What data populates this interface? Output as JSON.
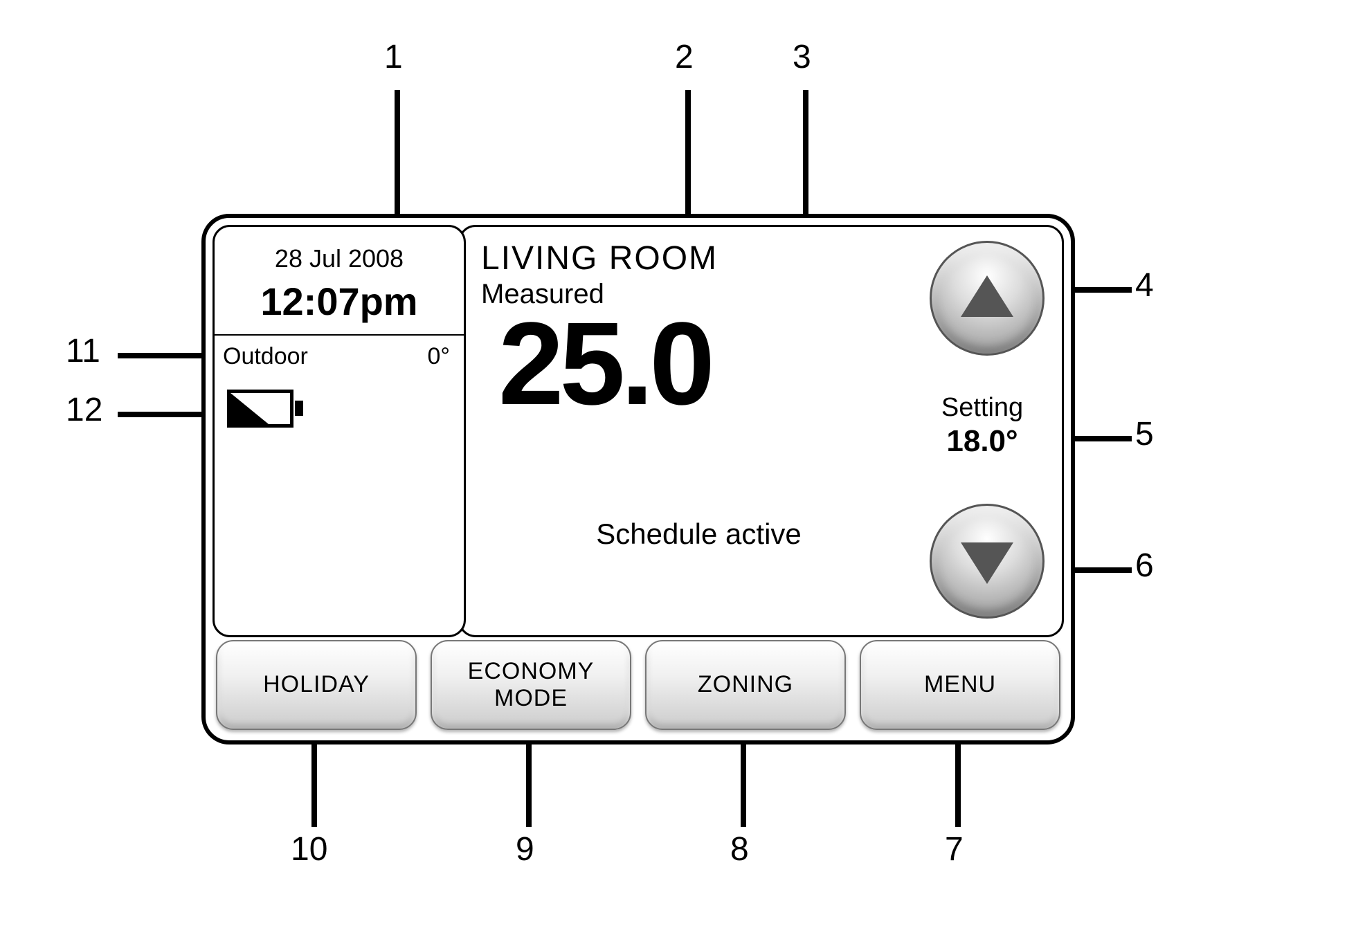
{
  "callouts": {
    "c1": "1",
    "c2": "2",
    "c3": "3",
    "c4": "4",
    "c5": "5",
    "c6": "6",
    "c7": "7",
    "c8": "8",
    "c9": "9",
    "c10": "10",
    "c11": "11",
    "c12": "12"
  },
  "left": {
    "date": "28 Jul 2008",
    "time": "12:07pm",
    "outdoor_label": "Outdoor",
    "outdoor_value": "0°"
  },
  "main": {
    "zone": "LIVING ROOM",
    "measured_label": "Measured",
    "temperature": "25.0",
    "schedule": "Schedule active",
    "setting_label": "Setting",
    "setting_value": "18.0°"
  },
  "buttons": {
    "holiday": "HOLIDAY",
    "economy": "ECONOMY\nMODE",
    "zoning": "ZONING",
    "menu": "MENU"
  }
}
